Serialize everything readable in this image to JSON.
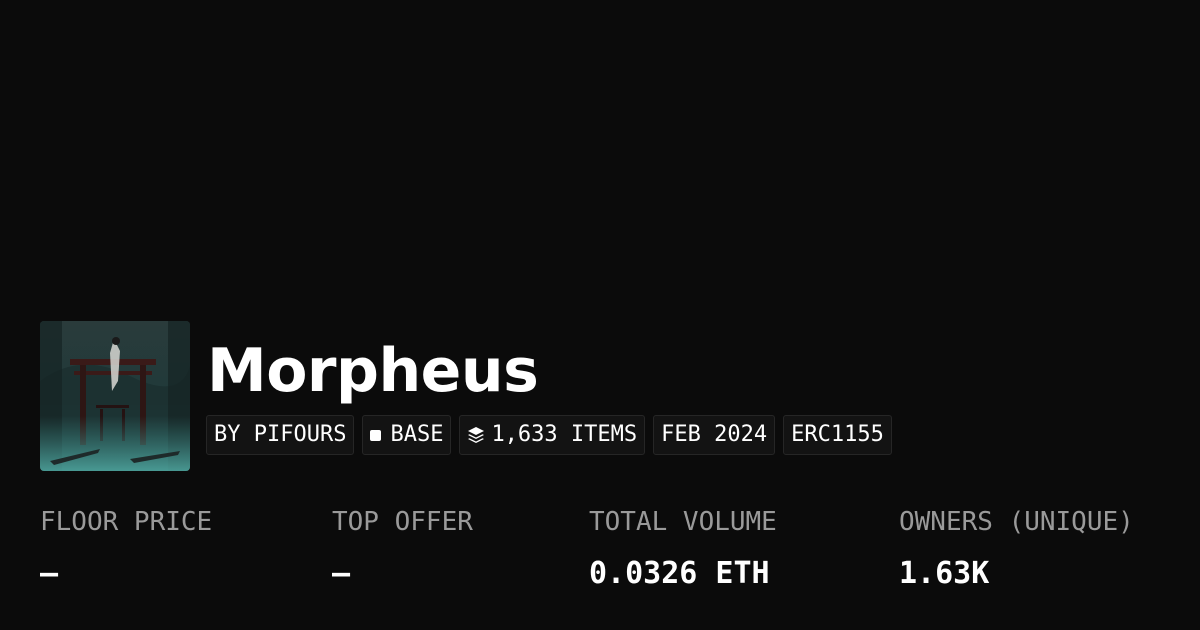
{
  "collection": {
    "name": "Morpheus",
    "image_icon": "torii-gate-artwork"
  },
  "badges": [
    {
      "label": "BY PIFOURS",
      "icon": ""
    },
    {
      "label": "BASE",
      "icon": "square-icon"
    },
    {
      "label": "1,633 ITEMS",
      "icon": "layers-icon"
    },
    {
      "label": "FEB 2024",
      "icon": ""
    },
    {
      "label": "ERC1155",
      "icon": ""
    }
  ],
  "stats": [
    {
      "label": "FLOOR PRICE",
      "value": "—"
    },
    {
      "label": "TOP OFFER",
      "value": "—"
    },
    {
      "label": "TOTAL VOLUME",
      "value": "0.0326 ETH"
    },
    {
      "label": "OWNERS (UNIQUE)",
      "value": "1.63K"
    }
  ],
  "colors": {
    "background": "#0b0b0b",
    "text": "#ffffff",
    "muted_text": "#9a9a9a",
    "badge_bg": "#131313",
    "badge_border": "#262626"
  }
}
